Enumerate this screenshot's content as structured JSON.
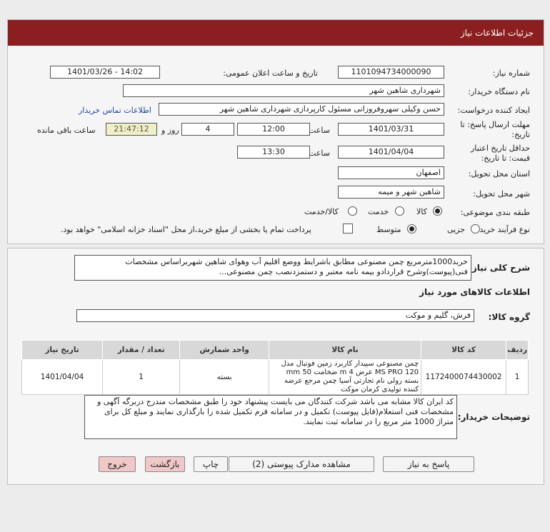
{
  "header": {
    "title": "جزئیات اطلاعات نیاز"
  },
  "form": {
    "need_number_label": "شماره نیاز:",
    "need_number": "1101094734000090",
    "announce_label": "تاریخ و ساعت اعلان عمومی:",
    "announce_value": "1401/03/26 - 14:02",
    "buyer_label": "نام دستگاه خریدار:",
    "buyer_value": "شهرداری شاهین شهر",
    "creator_label": "ایجاد کننده درخواست:",
    "creator_value": "حسن وکیلی سهروفروزانی مسئول کارپردازی شهرداری شاهین شهر",
    "contact_link": "اطلاعات تماس خریدار",
    "deadline_label": "مهلت ارسال پاسخ: تا تاریخ:",
    "deadline_date": "1401/03/31",
    "time_label": "ساعت",
    "deadline_time": "12:00",
    "days_value": "4",
    "days_label": "روز و",
    "remaining_time": "21:47:12",
    "remaining_label": "ساعت باقی مانده",
    "validity_label": "حداقل تاریخ اعتبار قیمت: تا تاریخ:",
    "validity_date": "1401/04/04",
    "validity_time": "13:30",
    "province_label": "استان محل تحویل:",
    "province_value": "اصفهان",
    "city_label": "شهر محل تحویل:",
    "city_value": "شاهین شهر و میمه",
    "category_label": "طبقه بندی موضوعی:",
    "category_options": [
      "کالا",
      "خدمت",
      "کالا/خدمت"
    ],
    "category_selected": "کالا",
    "process_label": "نوع فرآیند خرید :",
    "process_options": [
      "جزیی",
      "متوسط"
    ],
    "process_selected": "متوسط",
    "payment_note": "پرداخت تمام یا بخشی از مبلغ خرید،از محل \"اسناد خزانه اسلامی\" خواهد بود."
  },
  "details": {
    "summary_label": "شرح کلی نیاز:",
    "summary_value": "خرید1000مترمربع چمن مصنوعی مطابق باشرایط ووضع اقلیم آب وهوای شاهین شهربراساس مشخصات فنی(پیوست)وشرح قراردادو بیمه نامه معتبر و دستمزدنصب چمن مصنوعی...",
    "goods_info_title": "اطلاعات کالاهای مورد نیاز",
    "group_label": "گروه کالا:",
    "group_value": "فرش، گلیم و موکت",
    "table_headers": [
      "ردیف",
      "کد کالا",
      "نام کالا",
      "واحد شمارش",
      "تعداد / مقدار",
      "تاریخ نیاز"
    ],
    "table_rows": [
      {
        "row": "1",
        "code": "1172400074430002",
        "name": "چمن مصنوعی سپیدار کاربرد زمین فوتبال مدل MS PRO 120 عرض 4 m ضخامت 50 mm بسته رولی نام تجارتی آسیا چمن مرجع عرضه کننده تولیدی کرمان موکت",
        "unit": "بسته",
        "qty": "1",
        "date": "1401/04/04"
      }
    ],
    "buyer_notes_label": "توضیحات خریدار:",
    "buyer_notes": "کد ایران کالا مشابه می باشد شرکت کنندگان می بایست پیشنهاد خود را طبق مشخصات مندرج دربرگه آگهی و مشخصات فنی  استعلام(فایل پیوست) تکمیل و در سامانه فرم تکمیل شده را بارگذاری نمایند و مبلغ کل برای متراژ 1000 متر مربع را در سامانه ثبت نمایند."
  },
  "buttons": {
    "reply": "پاسخ به نیاز",
    "attachments": "مشاهده مدارک پیوستی (2)",
    "print": "چاپ",
    "back": "بازگشت",
    "exit": "خروج"
  },
  "watermark": {
    "brand": "ParsNamadData"
  }
}
